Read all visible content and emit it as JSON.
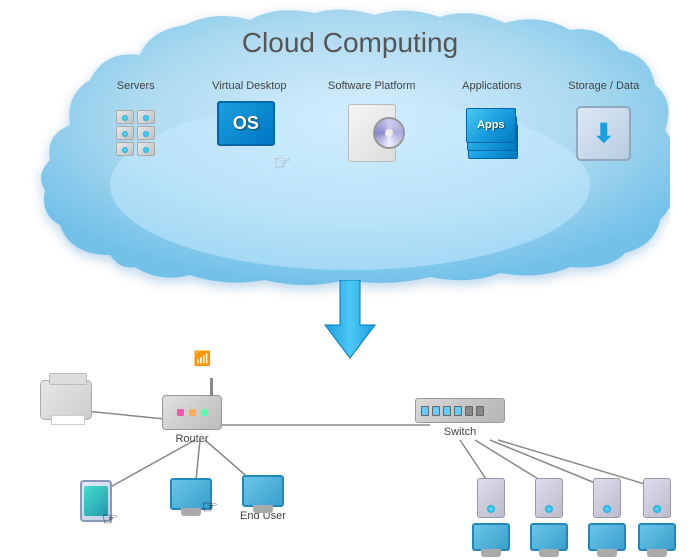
{
  "title": "Cloud Computing",
  "cloud": {
    "title": "Cloud Computing",
    "items": [
      {
        "id": "servers",
        "label": "Servers"
      },
      {
        "id": "virtual-desktop",
        "label": "Virtual Desktop"
      },
      {
        "id": "software-platform",
        "label": "Software Platform"
      },
      {
        "id": "applications",
        "label": "Applications"
      },
      {
        "id": "storage-data",
        "label": "Storage / Data"
      }
    ]
  },
  "network": {
    "devices": [
      {
        "id": "printer",
        "label": ""
      },
      {
        "id": "router",
        "label": "Router"
      },
      {
        "id": "switch",
        "label": "Switch"
      },
      {
        "id": "tablet",
        "label": ""
      },
      {
        "id": "end-user-computer",
        "label": ""
      },
      {
        "id": "end-user-label",
        "label": "End User"
      }
    ]
  },
  "os_label": "OS",
  "apps_label": "Apps"
}
